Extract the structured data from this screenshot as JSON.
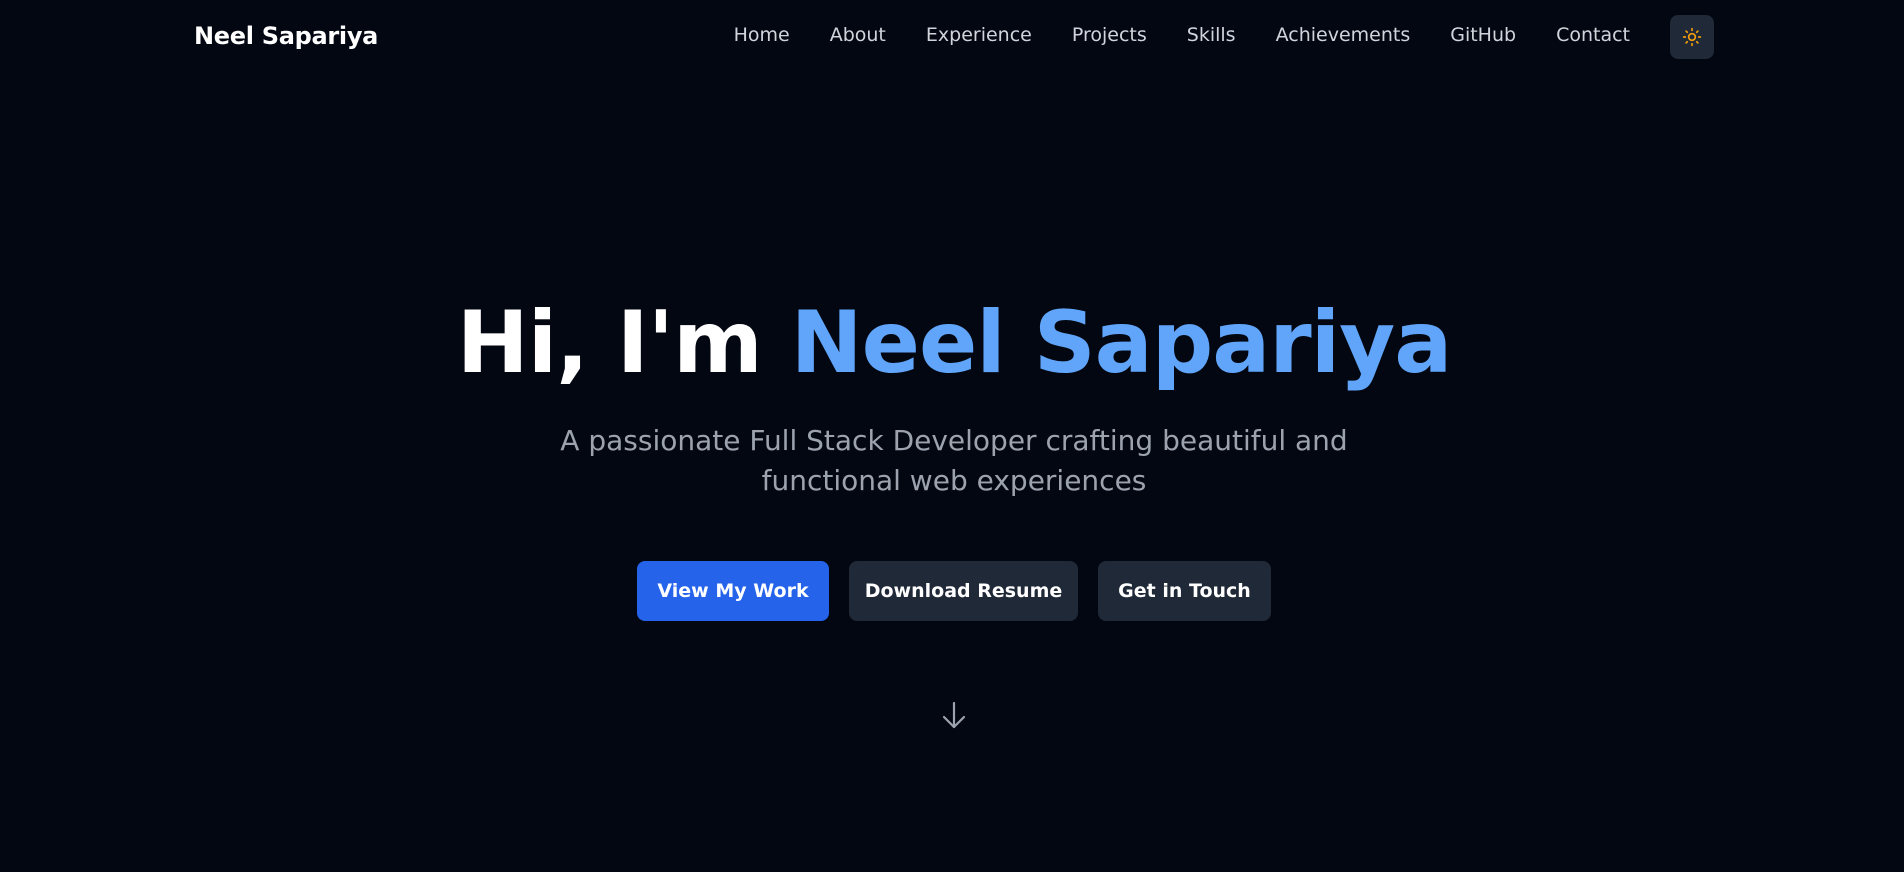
{
  "header": {
    "brand": "Neel Sapariya",
    "nav": [
      "Home",
      "About",
      "Experience",
      "Projects",
      "Skills",
      "Achievements",
      "GitHub",
      "Contact"
    ],
    "theme_toggle_icon": "sun-icon"
  },
  "hero": {
    "greeting": "Hi, I'm ",
    "name": "Neel Sapariya",
    "subtitle": "A passionate Full Stack Developer crafting beautiful and functional web experiences",
    "buttons": {
      "view_work": "View My Work",
      "download_resume": "Download Resume",
      "get_in_touch": "Get in Touch"
    },
    "scroll_icon": "arrow-down-icon"
  },
  "colors": {
    "background": "#030712",
    "accent": "#60a5fa",
    "primary_button": "#2563eb",
    "secondary_button": "#1f2937",
    "sun": "#f59e0b"
  }
}
